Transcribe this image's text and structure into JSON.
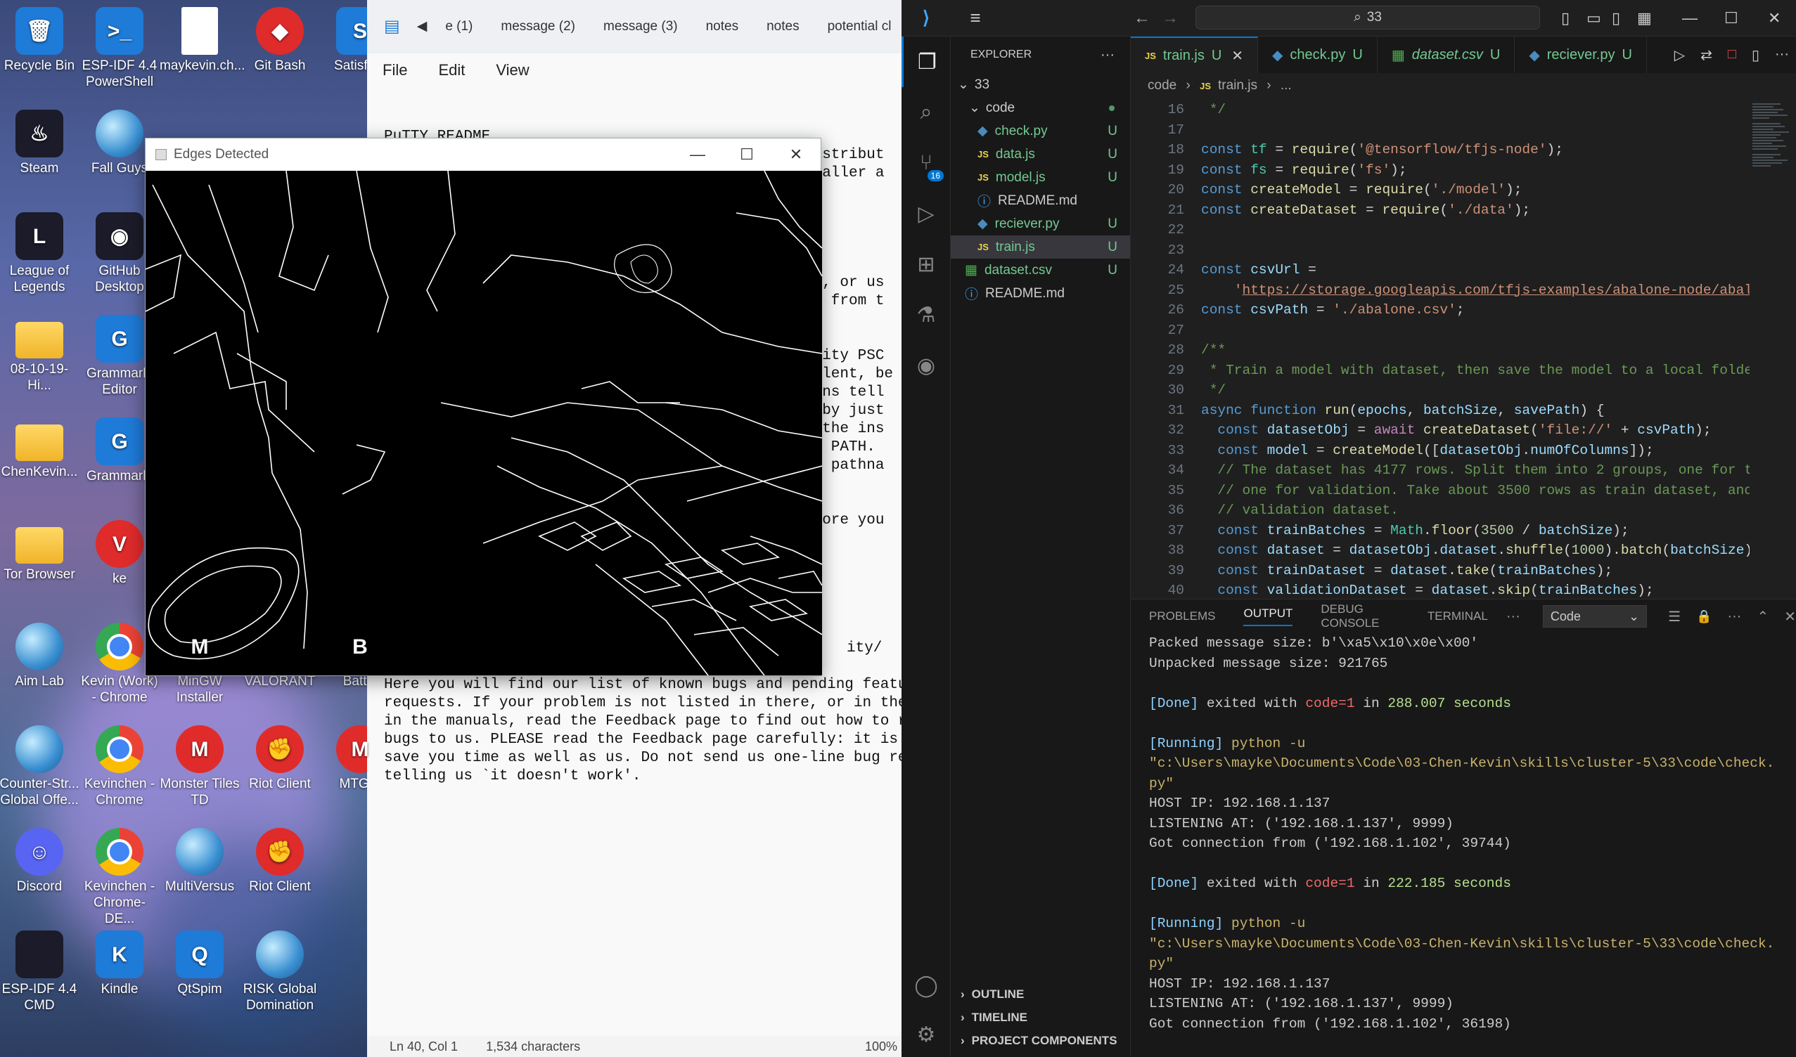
{
  "desktop_icons": [
    {
      "label": "Recycle Bin",
      "glyph": "🗑",
      "style": "g-blue"
    },
    {
      "label": "ESP-IDF 4.4 PowerShell",
      "glyph": ">_",
      "style": "g-blue"
    },
    {
      "label": "maykevin.ch...",
      "glyph": "",
      "style": "g-doc"
    },
    {
      "label": "Git Bash",
      "glyph": "◆",
      "style": "g-red"
    },
    {
      "label": "Satisfa...",
      "glyph": "S",
      "style": "g-blue"
    },
    {
      "label": "Steam",
      "glyph": "♨",
      "style": "g-dark"
    },
    {
      "label": "Fall Guys",
      "glyph": "",
      "style": "g-globe"
    },
    {
      "label": "League of Legends",
      "glyph": "L",
      "style": "g-dark"
    },
    {
      "label": "GitHub Desktop",
      "glyph": "◉",
      "style": "g-dark"
    },
    {
      "label": "08-10-19-Hi...",
      "glyph": "",
      "style": "g-folder"
    },
    {
      "label": "Grammarly Editor",
      "glyph": "G",
      "style": "g-blue"
    },
    {
      "label": "ChenKevin...",
      "glyph": "",
      "style": "g-folder"
    },
    {
      "label": "Grammarly",
      "glyph": "G",
      "style": "g-blue"
    },
    {
      "label": "Tor Browser",
      "glyph": "",
      "style": "g-folder"
    },
    {
      "label": "ke",
      "glyph": "V",
      "style": "g-red"
    },
    {
      "label": "Aim Lab",
      "glyph": "",
      "style": "g-globe"
    },
    {
      "label": "Kevin (Work) - Chrome",
      "glyph": "",
      "style": "g-chrome"
    },
    {
      "label": "MinGW Installer",
      "glyph": "M",
      "style": "g-blue"
    },
    {
      "label": "VALORANT",
      "glyph": "",
      "style": "g-red"
    },
    {
      "label": "Battle",
      "glyph": "B",
      "style": "g-blue"
    },
    {
      "label": "Counter-Str... Global Offe...",
      "glyph": "",
      "style": "g-globe"
    },
    {
      "label": "Kevinchen - Chrome",
      "glyph": "",
      "style": "g-chrome"
    },
    {
      "label": "Monster Tiles TD",
      "glyph": "M",
      "style": "g-red"
    },
    {
      "label": "Riot Client",
      "glyph": "✊",
      "style": "g-red"
    },
    {
      "label": "MTG A",
      "glyph": "M",
      "style": "g-red"
    },
    {
      "label": "Discord",
      "glyph": "☺",
      "style": "g-discord"
    },
    {
      "label": "Kevinchen - Chrome-DE...",
      "glyph": "",
      "style": "g-chrome"
    },
    {
      "label": "MultiVersus",
      "glyph": "",
      "style": "g-globe"
    },
    {
      "label": "Riot Client",
      "glyph": "✊",
      "style": "g-red"
    },
    {
      "label": "ESP-IDF 4.4 CMD",
      "glyph": "",
      "style": "g-dark"
    },
    {
      "label": "Kindle",
      "glyph": "K",
      "style": "g-blue"
    },
    {
      "label": "QtSpim",
      "glyph": "Q",
      "style": "g-blue"
    },
    {
      "label": "RISK Global Domination",
      "glyph": "",
      "style": "g-globe"
    }
  ],
  "notepad": {
    "tabs": [
      "e (1)",
      "message (2)",
      "message (3)",
      "notes",
      "notes",
      "potential cl"
    ],
    "menu": [
      "File",
      "Edit",
      "View"
    ],
    "lines_top": [
      "PuTTY README",
      "============"
    ],
    "right_fragments": [
      "distribut",
      "staller a",
      "",
      "",
      "",
      "",
      "",
      "rs, or us",
      "em from t",
      "",
      "",
      "ility PSC",
      "valent, be",
      "ions tell",
      "s by just",
      "d the ins",
      "ur PATH.",
      "ll pathna",
      "",
      "",
      "efore you",
      ".)",
      "",
      "",
      "",
      "",
      "",
      "",
      ""
    ],
    "ity_line": "ity/",
    "paragraph": [
      "Here you will find our list of known bugs and pending feature",
      "requests. If your problem is not listed in there, or in the FA",
      "in the manuals, read the Feedback page to find out how to repo",
      "bugs to us. PLEASE read the Feedback page carefully: it is the",
      "save you time as well as us. Do not send us one-line bug repo",
      "telling us `it doesn't work'."
    ],
    "status": {
      "position": "Ln 40, Col 1",
      "chars": "1,534 characters",
      "zoom": "100%"
    }
  },
  "edges_window": {
    "title": "Edges Detected"
  },
  "vscode": {
    "search": "33",
    "explorer_title": "EXPLORER",
    "root": "33",
    "folder": "code",
    "files": [
      {
        "name": "check.py",
        "kind": "py",
        "status": "U",
        "indent": 2
      },
      {
        "name": "data.js",
        "kind": "js",
        "status": "U",
        "indent": 2
      },
      {
        "name": "model.js",
        "kind": "js",
        "status": "U",
        "indent": 2
      },
      {
        "name": "README.md",
        "kind": "md",
        "status": "",
        "indent": 2
      },
      {
        "name": "reciever.py",
        "kind": "py",
        "status": "U",
        "indent": 2
      },
      {
        "name": "train.js",
        "kind": "js",
        "status": "U",
        "indent": 2,
        "selected": true
      },
      {
        "name": "dataset.csv",
        "kind": "csv",
        "status": "U",
        "indent": 1
      },
      {
        "name": "README.md",
        "kind": "md",
        "status": "",
        "indent": 1
      }
    ],
    "tabs": [
      {
        "name": "train.js",
        "kind": "js",
        "status": "U",
        "active": true
      },
      {
        "name": "check.py",
        "kind": "py",
        "status": "U"
      },
      {
        "name": "dataset.csv",
        "kind": "csv",
        "status": "U"
      },
      {
        "name": "reciever.py",
        "kind": "py",
        "status": "U"
      }
    ],
    "breadcrumb": [
      "code",
      "train.js",
      "..."
    ],
    "line_numbers": [
      "16",
      "17",
      "18",
      "19",
      "20",
      "21",
      "22",
      "23",
      "24",
      "25",
      "26",
      "27",
      "28",
      "29",
      "30",
      "31",
      "32",
      "33",
      "34",
      "35",
      "36",
      "37",
      "38",
      "39",
      "40"
    ],
    "panel_tabs": [
      "PROBLEMS",
      "OUTPUT",
      "DEBUG CONSOLE",
      "TERMINAL"
    ],
    "output_channel": "Code",
    "output_lines": [
      "Packed message size: b'\\xa5\\x10\\x0e\\x00'",
      "Unpacked message size: 921765",
      "",
      "[Done] exited with code=1 in 288.007 seconds",
      "",
      "[Running] python -u",
      "\"c:\\Users\\mayke\\Documents\\Code\\03-Chen-Kevin\\skills\\cluster-5\\33\\code\\check.",
      "py\"",
      "HOST IP: 192.168.1.137",
      "LISTENING AT: ('192.168.1.137', 9999)",
      "Got connection from ('192.168.1.102', 39744)",
      "",
      "[Done] exited with code=1 in 222.185 seconds",
      "",
      "[Running] python -u",
      "\"c:\\Users\\mayke\\Documents\\Code\\03-Chen-Kevin\\skills\\cluster-5\\33\\code\\check.",
      "py\"",
      "HOST IP: 192.168.1.137",
      "LISTENING AT: ('192.168.1.137', 9999)",
      "Got connection from ('192.168.1.102', 36198)"
    ],
    "bottom_sections": [
      "OUTLINE",
      "TIMELINE",
      "PROJECT COMPONENTS"
    ],
    "scm_badge": "16"
  }
}
